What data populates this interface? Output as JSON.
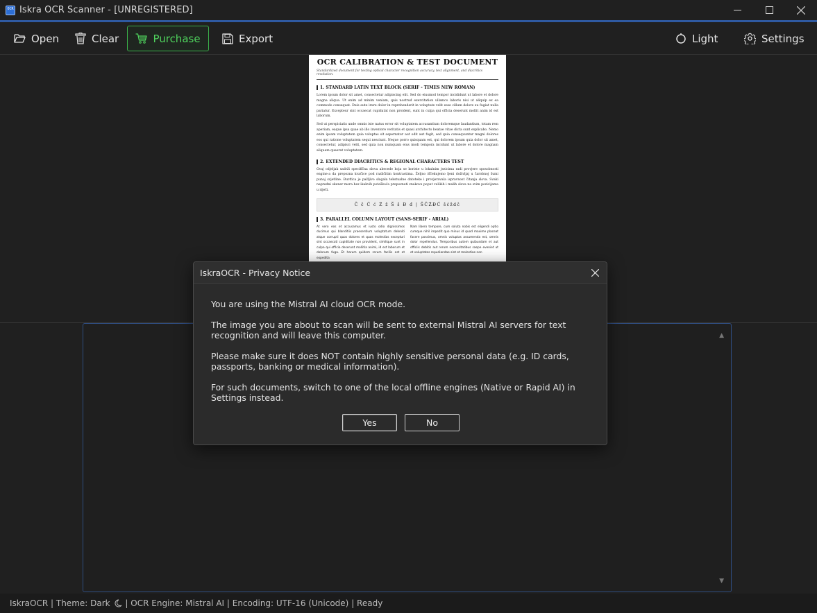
{
  "window": {
    "title": "Iskra OCR Scanner - [UNREGISTERED]",
    "app_icon_text": "OCR"
  },
  "toolbar": {
    "open_label": "Open",
    "clear_label": "Clear",
    "purchase_label": "Purchase",
    "export_label": "Export",
    "theme_label": "Light",
    "settings_label": "Settings",
    "purchase_color": "#4fd35d"
  },
  "document": {
    "title": "OCR CALIBRATION & TEST DOCUMENT",
    "subtitle": "Standardized document for testing optical character recognition accuracy, text alignment, and diacritics resolution.",
    "section1_heading": "1. STANDARD LATIN TEXT BLOCK (SERIF - TIMES NEW ROMAN)",
    "section1_p1": "Lorem ipsum dolor sit amet, consectetur adipiscing elit. Sed do eiusmod tempor incididunt ut labore et dolore magna aliqua. Ut enim ad minim veniam, quis nostrud exercitation ullamco laboris nisi ut aliquip ex ea commodo consequat. Duis aute irure dolor in reprehenderit in voluptate velit esse cillum dolore eu fugiat nulla pariatur. Excepteur sint occaecat cupidatat non proident, sunt in culpa qui officia deserunt mollit anim id est laborum.",
    "section1_p2": "Sed ut perspiciatis unde omnis iste natus error sit voluptatem accusantium doloremque laudantium, totam rem aperiam, eaque ipsa quae ab illo inventore veritatis et quasi architecto beatae vitae dicta sunt explicabo. Nemo enim ipsam voluptatem quia voluptas sit aspernatur aut odit aut fugit, sed quia consequuntur magni dolores eos qui ratione voluptatem sequi nesciunt. Neque porro quisquam est, qui dolorem ipsum quia dolor sit amet, consectetur, adipisci velit, sed quia non numquam eius modi tempora incidunt ut labore et dolore magnam aliquam quaerat voluptatem.",
    "section2_heading": "2. EXTENDED DIACRITICS & REGIONAL CHARACTERS TEST",
    "section2_p": "Ovaj odjeljak sadrži specifična slova abecede koja se koriste u lokalnim jezicima radi provjere sposobnosti engine-a da prepozna kvačice pod različitim kontrastima. Željno iščekujemo ljeni doživljaj u čarobnoj šumi punoj svjetline. Đurđica je pažljivo slagala tekstualne datoteke i provjeravala ispravnost čitanja slova. Svaki napredni skener mora bez ikakvih poteškoća prepoznati znakove poput velikih i malih slova na svim pozicijama u riječi.",
    "diacritics": "Č č Ć ć Ž ž Š š Đ đ | ŠČŽĐĆ šćždč",
    "section3_heading": "3. PARALLEL COLUMN LAYOUT (SANS-SERIF - ARIAL)",
    "col1": "At vero eos et accusamus et iusto odio dignissimos ducimus qui blanditiis praesentium voluptatum deleniti atque corrupti quos dolores et quas molestias excepturi sint occaecati cupiditate non provident, similique sunt in culpa qui officia deserunt mollitia animi, id est laborum et dolorum fuga. Et harum quidem rerum facilis est et expedita",
    "col2": "Nam libero tempore, cum soluta nobis est eligendi optio cumque nihil impedit quo minus id quod maxime placeat facere possimus, omnis voluptas assumenda est, omnis dolor repellendus. Temporibus autem quibusdam et aut officiis debitis aut rerum necessitatibus saepe eveniet ut et voluptates repudiandae sint et molestiae non"
  },
  "dialog": {
    "title": "IskraOCR - Privacy Notice",
    "p1": "You are using the Mistral AI cloud OCR mode.",
    "p2": "The image you are about to scan will be sent to external Mistral AI servers for text recognition and will leave this computer.",
    "p3": "Please make sure it does NOT contain highly sensitive personal data (e.g. ID cards, passports, banking or medical information).",
    "p4": "For such documents, switch to one of the local offline engines (Native or Rapid AI) in Settings instead.",
    "yes_label": "Yes",
    "no_label": "No"
  },
  "statusbar": {
    "app": "IskraOCR",
    "sep": " | ",
    "theme": "Theme: Dark",
    "engine": "OCR Engine: Mistral AI",
    "encoding": "Encoding: UTF-16 (Unicode)",
    "status": "Ready"
  },
  "colors": {
    "accent": "#2f5aa2",
    "background": "#202020",
    "purchase_green": "#3bb24a"
  },
  "icons": [
    "folder-open-icon",
    "trash-icon",
    "cart-icon",
    "save-icon",
    "theme-circle-icon",
    "gear-icon",
    "minimize-icon",
    "maximize-icon",
    "close-icon",
    "moon-icon"
  ]
}
